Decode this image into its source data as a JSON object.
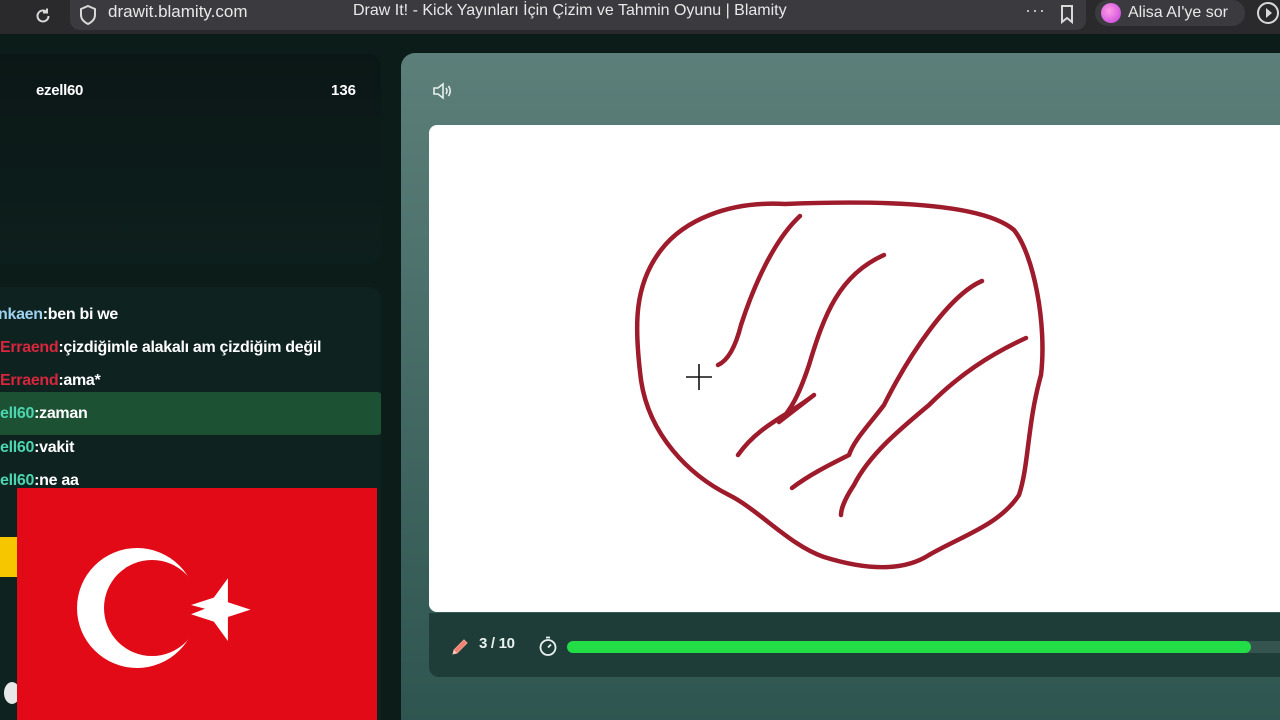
{
  "browser": {
    "url": "drawit.blamity.com",
    "page_title": "Draw It! - Kick Yayınları İçin Çizim ve Tahmin Oyunu | Blamity",
    "menu_dots": "···",
    "assistant_label": "Alisa AI'ye sor"
  },
  "leaderboard": {
    "player_name": "ezell60",
    "player_score": "136"
  },
  "chat": {
    "messages": [
      {
        "user": "nkaen",
        "text": ":ben bi we",
        "color": "blue",
        "highlight": false
      },
      {
        "user": "Erraend",
        "text": ":çizdiğimle alakalı am çizdiğim değil",
        "color": "red",
        "highlight": false
      },
      {
        "user": "Erraend",
        "text": ":ama*",
        "color": "red",
        "highlight": false
      },
      {
        "user": "ell60",
        "text": ":zaman",
        "color": "green",
        "highlight": true
      },
      {
        "user": "ell60",
        "text": ":vakit",
        "color": "green",
        "highlight": false
      },
      {
        "user": "ell60",
        "text": ":ne aa",
        "color": "green",
        "highlight": false
      }
    ]
  },
  "overlay": {
    "flag": "turkey-flag"
  },
  "game": {
    "round_label": "3 / 10",
    "timer_progress": 0.96,
    "colors": {
      "brush": "#9e1b2c",
      "progress": "#22dd46",
      "flag_red": "#e30a17"
    }
  }
}
